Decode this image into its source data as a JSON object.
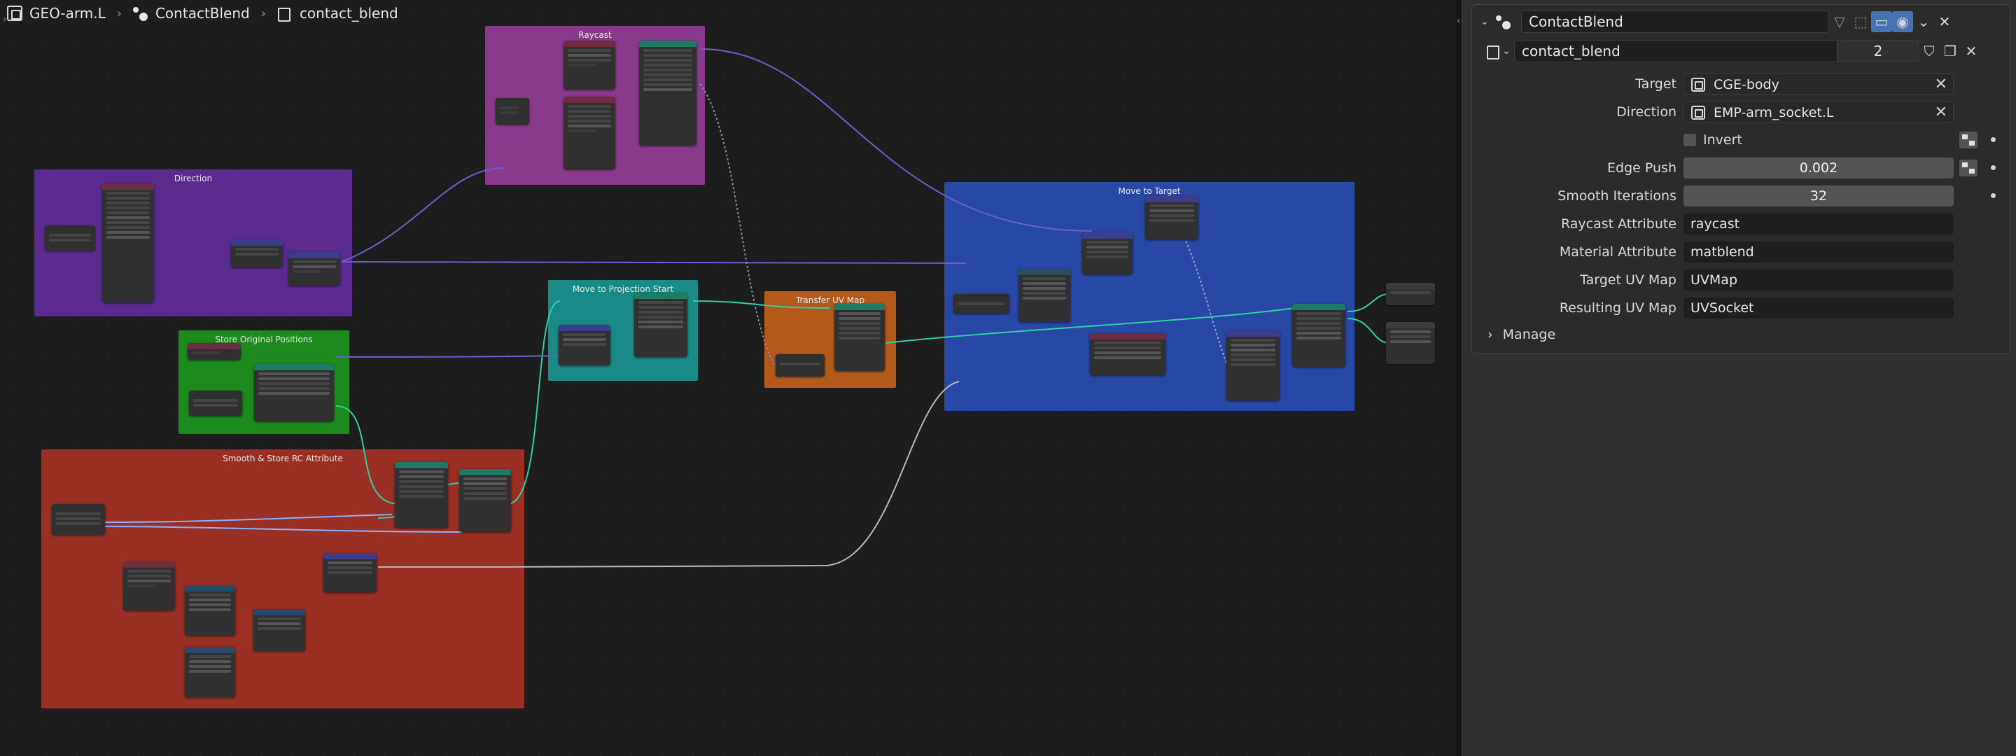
{
  "breadcrumb": {
    "object": "GEO-arm.L",
    "modifier": "ContactBlend",
    "node_tree": "contact_blend"
  },
  "frames": [
    {
      "id": "raycast",
      "label": "Raycast",
      "color": "#8a3a8c"
    },
    {
      "id": "direction",
      "label": "Direction",
      "color": "#5a2a8f"
    },
    {
      "id": "store",
      "label": "Store Original Positions",
      "color": "#1d8a1d"
    },
    {
      "id": "smooth",
      "label": "Smooth & Store RC Attribute",
      "color": "#9a2f23"
    },
    {
      "id": "moveproj",
      "label": "Move to Projection Start",
      "color": "#1a8a86"
    },
    {
      "id": "uvmap",
      "label": "Transfer UV Map",
      "color": "#b35a1a"
    },
    {
      "id": "target",
      "label": "Move to Target",
      "color": "#2848a6"
    }
  ],
  "modifier": {
    "name": "ContactBlend",
    "node_group": "contact_blend",
    "users": "2",
    "fields": {
      "target": {
        "label": "Target",
        "value": "CGE-body"
      },
      "direction": {
        "label": "Direction",
        "value": "EMP-arm_socket.L"
      },
      "invert": {
        "label": "Invert"
      },
      "edge_push": {
        "label": "Edge Push",
        "value": "0.002"
      },
      "smooth_iterations": {
        "label": "Smooth Iterations",
        "value": "32"
      },
      "raycast_attribute": {
        "label": "Raycast Attribute",
        "value": "raycast"
      },
      "material_attribute": {
        "label": "Material Attribute",
        "value": "matblend"
      },
      "target_uv_map": {
        "label": "Target UV Map",
        "value": "UVMap"
      },
      "resulting_uv_map": {
        "label": "Resulting UV Map",
        "value": "UVSocket"
      }
    },
    "manage_label": "Manage"
  }
}
